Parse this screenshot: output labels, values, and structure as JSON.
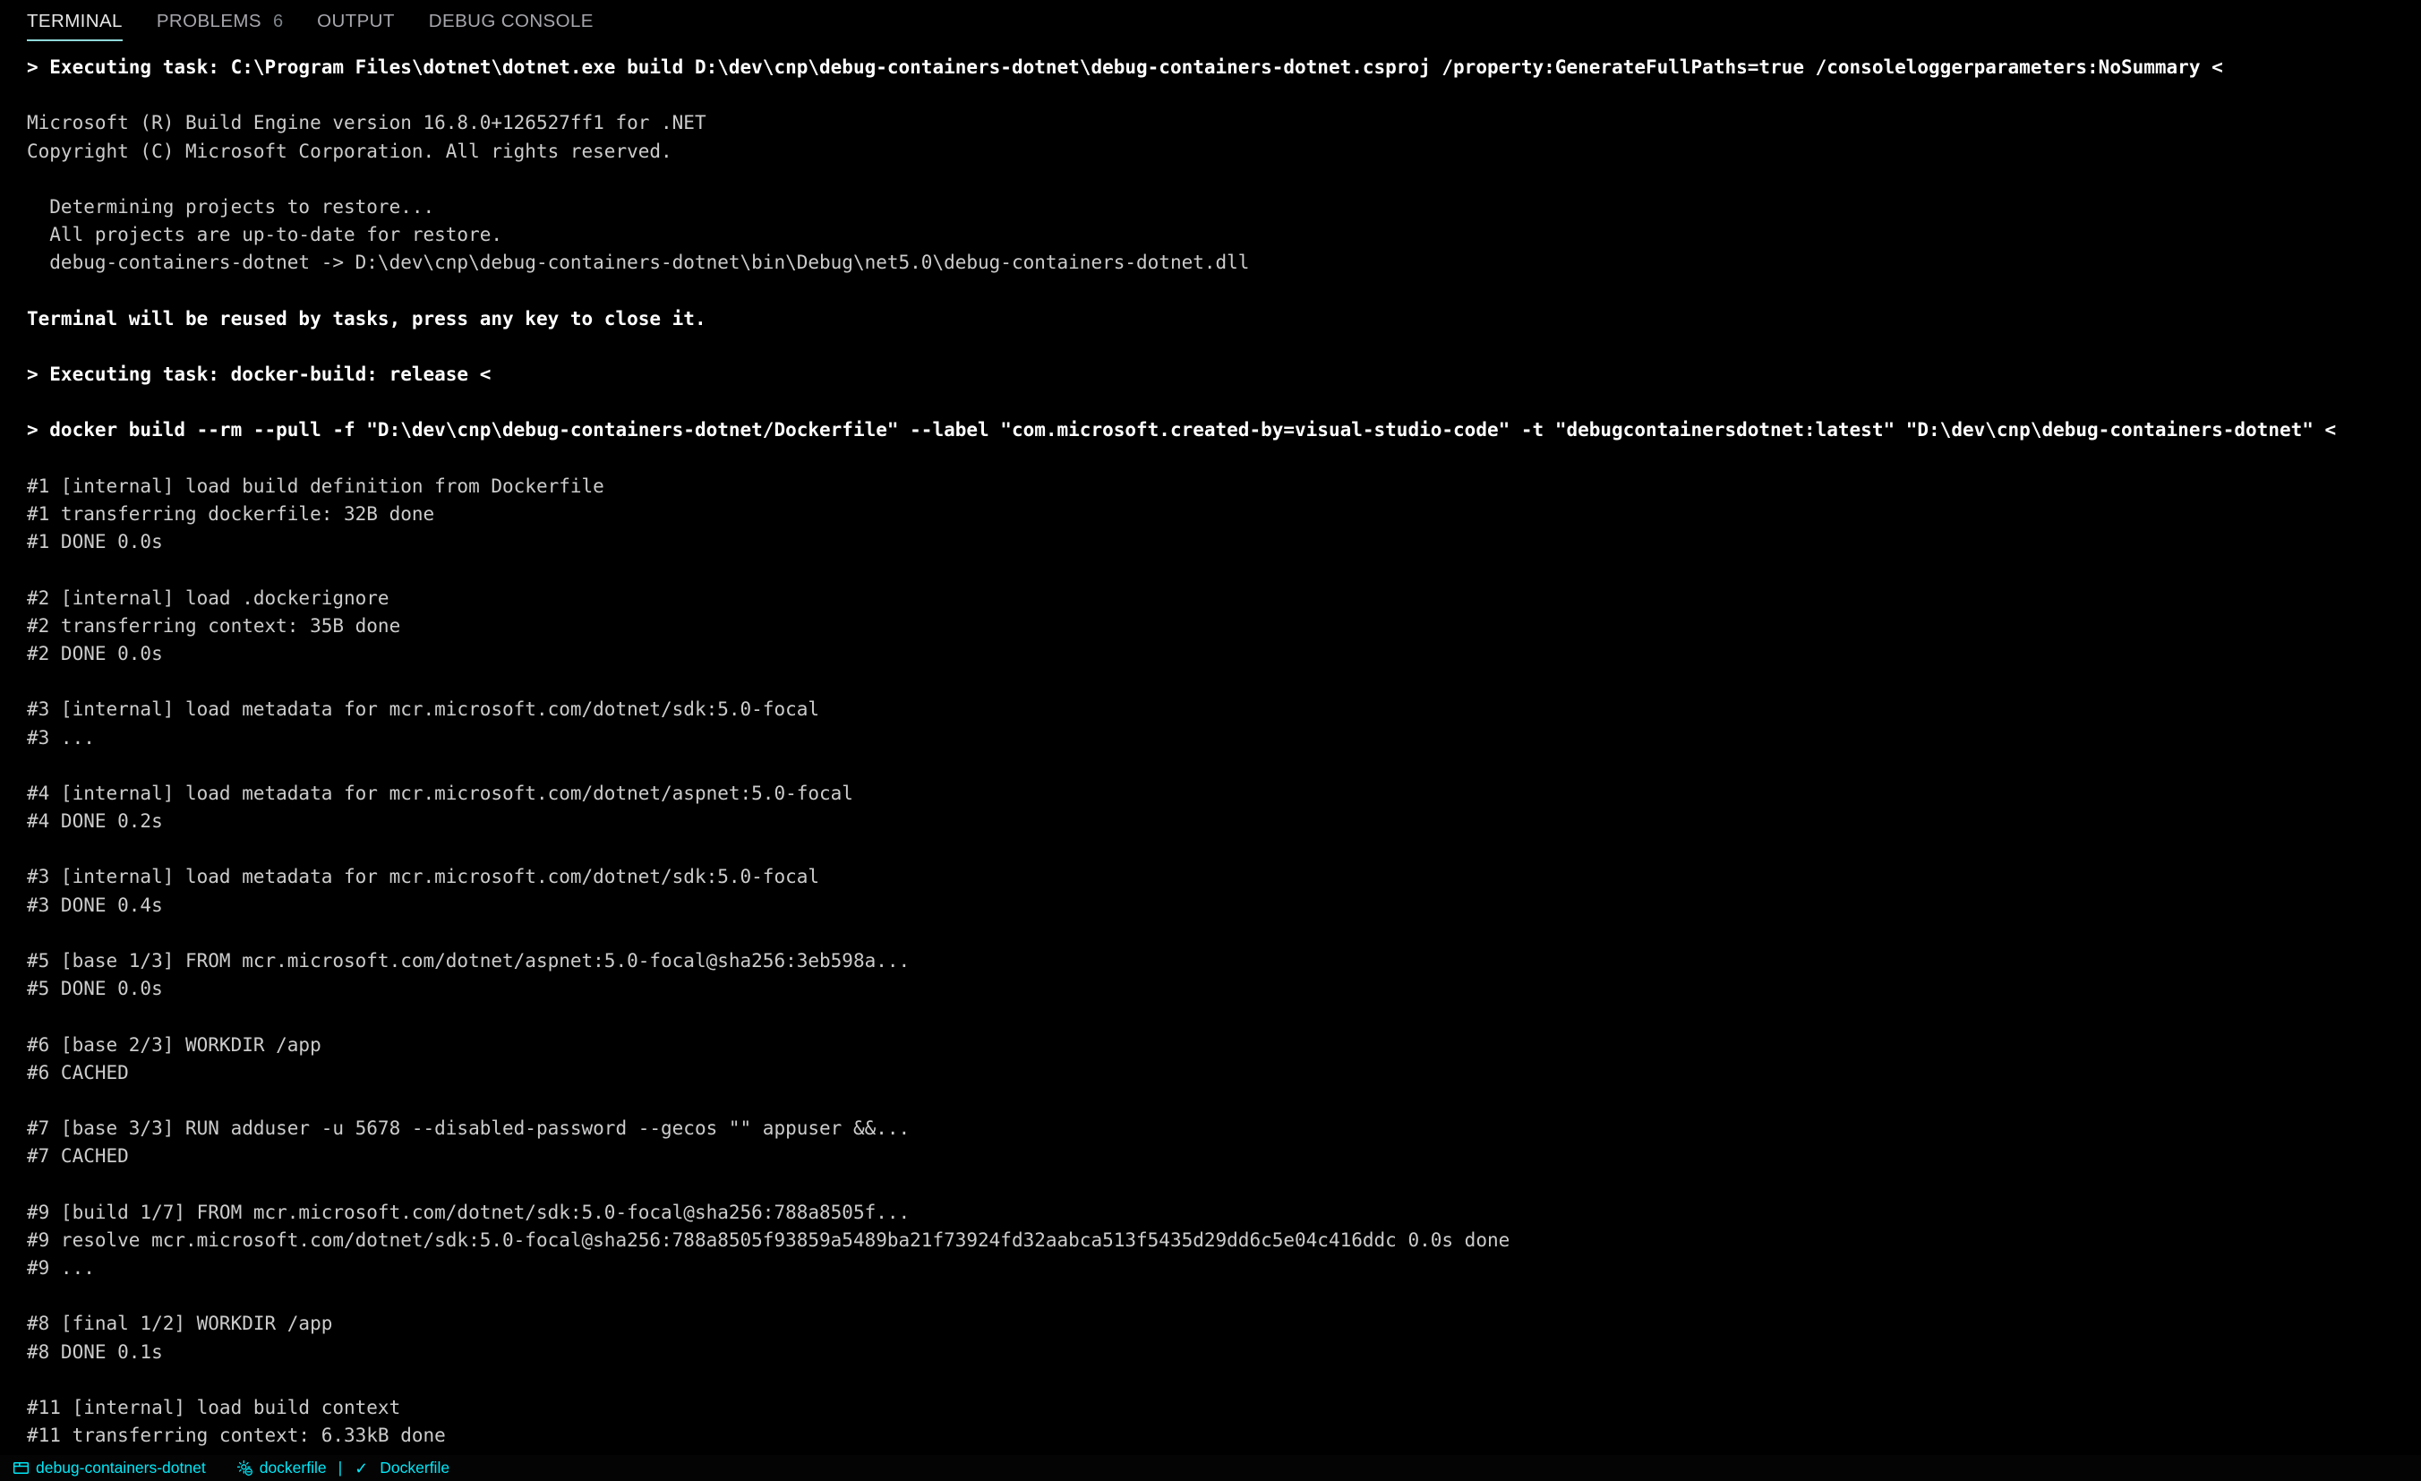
{
  "panel": {
    "tabs": [
      {
        "label": "TERMINAL",
        "count": "",
        "active": true,
        "name": "tab-terminal"
      },
      {
        "label": "PROBLEMS",
        "count": "6",
        "active": false,
        "name": "tab-problems"
      },
      {
        "label": "OUTPUT",
        "count": "",
        "active": false,
        "name": "tab-output"
      },
      {
        "label": "DEBUG CONSOLE",
        "count": "",
        "active": false,
        "name": "tab-debug-console"
      }
    ],
    "active_tab_underline_color": "#8fd9da"
  },
  "terminal": {
    "foreground_color": "#cccccc",
    "background_color": "#000000",
    "lines": [
      {
        "text": "> Executing task: C:\\Program Files\\dotnet\\dotnet.exe build D:\\dev\\cnp\\debug-containers-dotnet\\debug-containers-dotnet.csproj /property:GenerateFullPaths=true /consoleloggerparameters:NoSummary <",
        "bold": true
      },
      {
        "text": "",
        "bold": false
      },
      {
        "text": "Microsoft (R) Build Engine version 16.8.0+126527ff1 for .NET",
        "bold": false
      },
      {
        "text": "Copyright (C) Microsoft Corporation. All rights reserved.",
        "bold": false
      },
      {
        "text": "",
        "bold": false
      },
      {
        "text": "  Determining projects to restore...",
        "bold": false
      },
      {
        "text": "  All projects are up-to-date for restore.",
        "bold": false
      },
      {
        "text": "  debug-containers-dotnet -> D:\\dev\\cnp\\debug-containers-dotnet\\bin\\Debug\\net5.0\\debug-containers-dotnet.dll",
        "bold": false
      },
      {
        "text": "",
        "bold": false
      },
      {
        "text": "Terminal will be reused by tasks, press any key to close it.",
        "bold": true
      },
      {
        "text": "",
        "bold": false
      },
      {
        "text": "> Executing task: docker-build: release <",
        "bold": true
      },
      {
        "text": "",
        "bold": false
      },
      {
        "text": "> docker build --rm --pull -f \"D:\\dev\\cnp\\debug-containers-dotnet/Dockerfile\" --label \"com.microsoft.created-by=visual-studio-code\" -t \"debugcontainersdotnet:latest\" \"D:\\dev\\cnp\\debug-containers-dotnet\" <",
        "bold": true
      },
      {
        "text": "",
        "bold": false
      },
      {
        "text": "#1 [internal] load build definition from Dockerfile",
        "bold": false
      },
      {
        "text": "#1 transferring dockerfile: 32B done",
        "bold": false
      },
      {
        "text": "#1 DONE 0.0s",
        "bold": false
      },
      {
        "text": "",
        "bold": false
      },
      {
        "text": "#2 [internal] load .dockerignore",
        "bold": false
      },
      {
        "text": "#2 transferring context: 35B done",
        "bold": false
      },
      {
        "text": "#2 DONE 0.0s",
        "bold": false
      },
      {
        "text": "",
        "bold": false
      },
      {
        "text": "#3 [internal] load metadata for mcr.microsoft.com/dotnet/sdk:5.0-focal",
        "bold": false
      },
      {
        "text": "#3 ...",
        "bold": false
      },
      {
        "text": "",
        "bold": false
      },
      {
        "text": "#4 [internal] load metadata for mcr.microsoft.com/dotnet/aspnet:5.0-focal",
        "bold": false
      },
      {
        "text": "#4 DONE 0.2s",
        "bold": false
      },
      {
        "text": "",
        "bold": false
      },
      {
        "text": "#3 [internal] load metadata for mcr.microsoft.com/dotnet/sdk:5.0-focal",
        "bold": false
      },
      {
        "text": "#3 DONE 0.4s",
        "bold": false
      },
      {
        "text": "",
        "bold": false
      },
      {
        "text": "#5 [base 1/3] FROM mcr.microsoft.com/dotnet/aspnet:5.0-focal@sha256:3eb598a...",
        "bold": false
      },
      {
        "text": "#5 DONE 0.0s",
        "bold": false
      },
      {
        "text": "",
        "bold": false
      },
      {
        "text": "#6 [base 2/3] WORKDIR /app",
        "bold": false
      },
      {
        "text": "#6 CACHED",
        "bold": false
      },
      {
        "text": "",
        "bold": false
      },
      {
        "text": "#7 [base 3/3] RUN adduser -u 5678 --disabled-password --gecos \"\" appuser &&...",
        "bold": false
      },
      {
        "text": "#7 CACHED",
        "bold": false
      },
      {
        "text": "",
        "bold": false
      },
      {
        "text": "#9 [build 1/7] FROM mcr.microsoft.com/dotnet/sdk:5.0-focal@sha256:788a8505f...",
        "bold": false
      },
      {
        "text": "#9 resolve mcr.microsoft.com/dotnet/sdk:5.0-focal@sha256:788a8505f93859a5489ba21f73924fd32aabca513f5435d29dd6c5e04c416ddc 0.0s done",
        "bold": false
      },
      {
        "text": "#9 ...",
        "bold": false
      },
      {
        "text": "",
        "bold": false
      },
      {
        "text": "#8 [final 1/2] WORKDIR /app",
        "bold": false
      },
      {
        "text": "#8 DONE 0.1s",
        "bold": false
      },
      {
        "text": "",
        "bold": false
      },
      {
        "text": "#11 [internal] load build context",
        "bold": false
      },
      {
        "text": "#11 transferring context: 6.33kB done",
        "bold": false
      }
    ]
  },
  "status_bar": {
    "accent_color": "#00e8f8",
    "background_color": "#040404",
    "branch_label": "debug-containers-dotnet",
    "branch_icon": "source-control-folder-icon",
    "task_label": "dockerfile",
    "task_icon": "gear-minus-icon",
    "separator": "|",
    "check_glyph": "✓",
    "linter_label": "Dockerfile"
  }
}
